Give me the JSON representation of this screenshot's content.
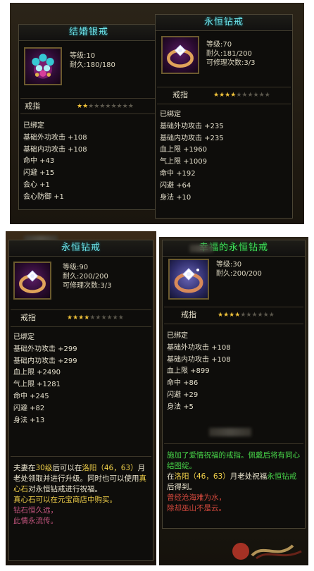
{
  "items": [
    {
      "id": "wedding-silver-ring",
      "title": "结婚银戒",
      "title_color": "#6fe3e8",
      "stats": [
        "等级:10",
        "耐久:180/180"
      ],
      "type_label": "戒指",
      "stars_on": 2,
      "stars_total": 10,
      "attributes": [
        "已绑定",
        "基础外功攻击 +108",
        "基础内功攻击 +108",
        "命中 +43",
        "闪避 +15",
        "会心 +1",
        "会心防御 +1"
      ]
    },
    {
      "id": "eternal-diamond-ring-70",
      "title": "永恒钻戒",
      "title_color": "#6fe3e8",
      "stats": [
        "等级:70",
        "耐久:181/200",
        "可修理次数:3/3"
      ],
      "type_label": "戒指",
      "stars_on": 4,
      "stars_total": 10,
      "attributes": [
        "已绑定",
        "基础外功攻击 +235",
        "基础内功攻击 +235",
        "血上限 +1960",
        "气上限 +1009",
        "命中 +192",
        "闪避 +64",
        "身法 +10"
      ]
    },
    {
      "id": "eternal-diamond-ring-90",
      "title": "永恒钻戒",
      "title_color": "#6fe3e8",
      "stats": [
        "等级:90",
        "耐久:200/200",
        "可修理次数:3/3"
      ],
      "type_label": "戒指",
      "stars_on": 4,
      "stars_total": 10,
      "attributes": [
        "已绑定",
        "基础外功攻击 +299",
        "基础内功攻击 +299",
        "血上限 +2490",
        "气上限 +1281",
        "命中 +245",
        "闪避 +82",
        "身法 +13"
      ],
      "description": {
        "part1": "夫妻在",
        "level": "30级",
        "part2": "后可以在",
        "place": "洛阳（46，63）",
        "part3": "月老处领取并进行升级。同时也可以使用",
        "stone": "真心石",
        "part4": "对永恒钻戒进行祝福。",
        "part5": "真心石可以在",
        "shop": "元宝商店",
        "part6": "中购买。",
        "poem1": "钻石恒久远，",
        "poem2": "此情永流传。"
      }
    },
    {
      "id": "blessed-eternal-diamond-ring",
      "title": "幸福的永恒钻戒",
      "title_color": "#3fe05a",
      "stats": [
        "等级:30",
        "耐久:200/200"
      ],
      "type_label": "戒指",
      "stars_on": 4,
      "stars_total": 10,
      "attributes": [
        "已绑定",
        "基础外功攻击 +108",
        "基础内功攻击 +108",
        "血上限 +899",
        "命中 +86",
        "闪避 +29",
        "身法 +5"
      ],
      "description": {
        "line1": "施加了爱情祝福的戒指。佩戴后将有同心结图绽。",
        "line2a": "在",
        "place": "洛阳（46，63）",
        "line2b": "月老处祝福",
        "ring": "永恒钻戒",
        "line2c": "后得到。",
        "poem1": "曾经沧海难为水，",
        "poem2": "除却巫山不是云。"
      }
    }
  ],
  "colors": {
    "star_on": "#f0c23a",
    "star_off": "#5b574c",
    "text_yellow": "#f3d24a",
    "text_green": "#48d84a",
    "text_pink": "#c4557f"
  }
}
